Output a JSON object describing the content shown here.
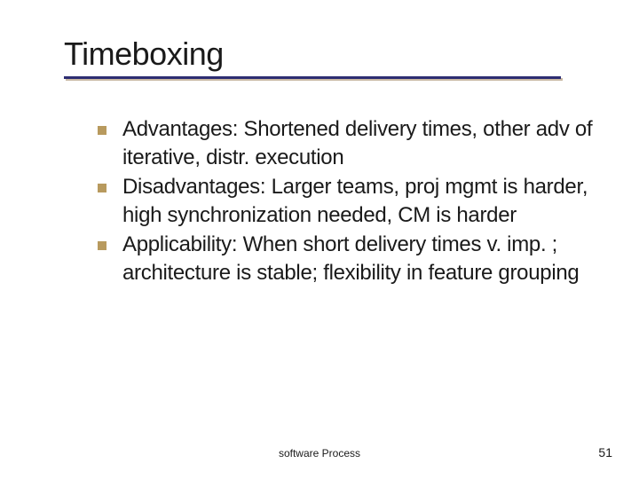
{
  "title": "Timeboxing",
  "bullets": [
    {
      "text": "Advantages: Shortened delivery times, other adv of iterative, distr. execution"
    },
    {
      "text": "Disadvantages: Larger teams, proj mgmt is harder, high synchronization needed, CM is harder"
    },
    {
      "text": "Applicability: When short delivery times v. imp. ; architecture is stable; flexibility in feature grouping"
    }
  ],
  "footer": "software Process",
  "page_number": "51"
}
